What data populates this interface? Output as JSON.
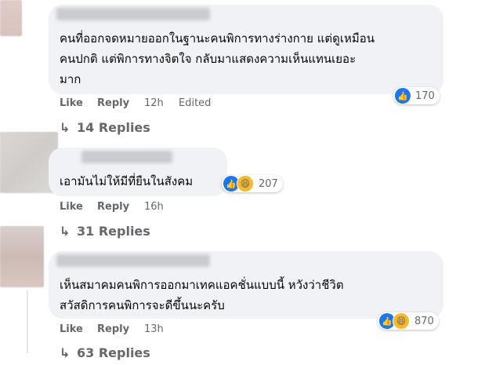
{
  "comments": [
    {
      "text_lines": [
        "คนที่ออกจดหมายออกในฐานะคนพิการทางร่างกาย แต่ดูเหมือน",
        "คนปกติ แต่พิการทางจิตใจ กลับมาแสดงความเห็นแทนเยอะ",
        "มาก"
      ],
      "like_label": "Like",
      "reply_label": "Reply",
      "time": "12h",
      "edited": "Edited",
      "reactions": "170",
      "replies_label": "14 Replies"
    },
    {
      "text_lines": [
        "เอามันไม่ให้มีที่ยืนในสังคม"
      ],
      "like_label": "Like",
      "reply_label": "Reply",
      "time": "16h",
      "reactions": "207",
      "replies_label": "31 Replies"
    },
    {
      "text_lines": [
        "เห็นสมาคมคนพิการออกมาเทคแอคชั่นแบบนี้ หวังว่าชีวิต",
        "สวัสดิการคนพิการจะดีขึ้นนะครับ"
      ],
      "like_label": "Like",
      "reply_label": "Reply",
      "time": "13h",
      "reactions": "870",
      "replies_label": "63 Replies"
    }
  ],
  "icons": {
    "like": "like-thumb-icon",
    "haha": "haha-emoji-icon",
    "reply_arrow": "reply-arrow-icon"
  },
  "colors": {
    "bubble": "#f0f2f5",
    "meta": "#65676b",
    "like_blue": "#1877f2",
    "haha_yellow": "#f7b928"
  }
}
